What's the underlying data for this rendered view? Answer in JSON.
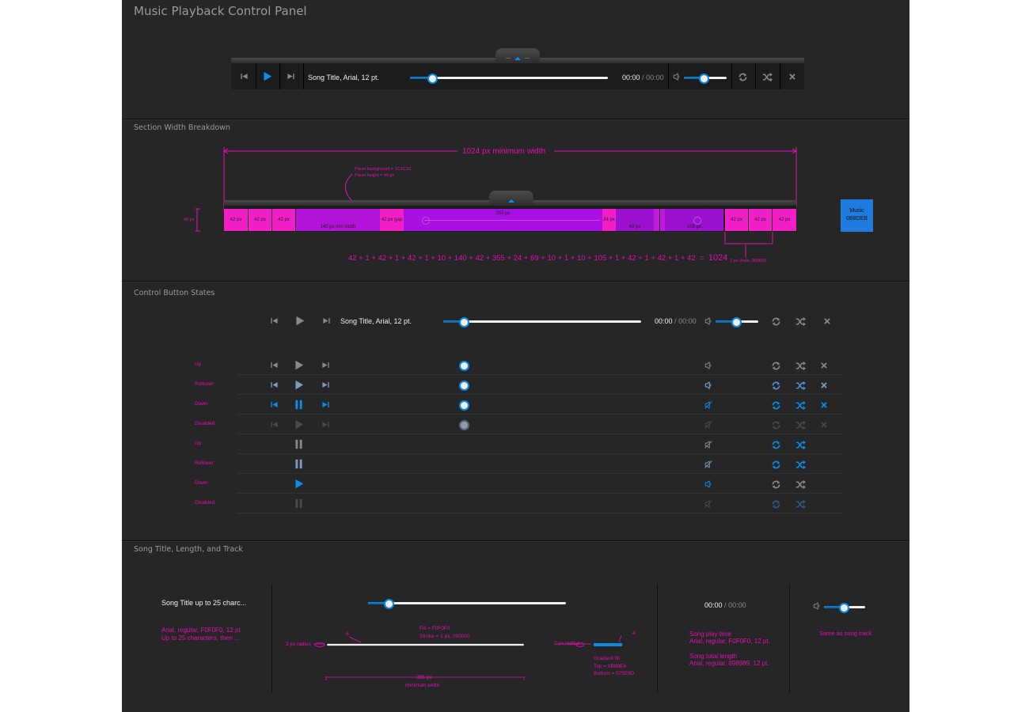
{
  "title": "Music Playback Control Panel",
  "player": {
    "song_title": "Song Title, Arial, 12 pt.",
    "time_current": "00:00",
    "time_sep": "/",
    "time_total": "00:00"
  },
  "sections": {
    "width": "Section Width Breakdown",
    "states": "Control Button States",
    "title": "Song Title, Length, and Track"
  },
  "breakdown": {
    "min_width": "1024 px minimum width",
    "panel_note_1": "Panel background = 1C1C1C",
    "panel_note_2": "Panel height = 40 px",
    "height_label": "40 px",
    "boxes": [
      "42 px",
      "42 px",
      "42 px",
      "140 px min width",
      "42 px gap",
      "355 px",
      "24 px",
      "69 px",
      "105 px",
      "42 px",
      "42 px",
      "42 px"
    ],
    "formula": "42 + 1 + 42 + 1 + 42 + 1 + 10 + 140 + 42 + 355 + 24 + 69 + 10 + 1 + 10 + 105 + 1 + 42 + 1 + 42 + 1 + 42",
    "formula_eq": "=",
    "formula_total": "1024",
    "divide_note": "1 px Vrule, 000000",
    "swatch_line1": "Music",
    "swatch_line2": "0B8DEB"
  },
  "states": {
    "labels": [
      "Up",
      "Rollover",
      "Down",
      "Disabled",
      "Up",
      "Rollover",
      "Down",
      "Disabled"
    ]
  },
  "spec": {
    "song_title": "Song Title up to 25 charc...",
    "title_note_1": "Arial, regular, F0F0F0, 12 pt",
    "title_note_2": "Up to 25 characters, then ...",
    "fill_note": "Fill = F0F0F0",
    "stroke_note": "Stroke = 1 px, 000000",
    "radius_left": "3 px radius",
    "radius_right": "2 px radius",
    "six": "6",
    "four": "4",
    "track_width": "355 px",
    "min_width": "minimum width",
    "gradient_1": "Gradient fill",
    "gradient_2": "Top = 0B89E4",
    "gradient_3": "Bottom = 075E9D",
    "time_current": "00:00",
    "time_sep": "/",
    "time_total": "00:00",
    "play_time_1": "Song play time",
    "play_time_2": "Arial, regular, F0F0F0, 12 pt.",
    "total_len_1": "Song total length",
    "total_len_2": "Arial, regular, 898989, 12 pt.",
    "same_as_track": "Same as song track"
  },
  "colors": {
    "frame": "#262626",
    "panel": "#1C1C1C",
    "accent": "#0B8DEB",
    "annotation": "#E60FB4",
    "icon_gray": "#898989"
  },
  "icons": [
    "prev-icon",
    "play-icon",
    "pause-icon",
    "next-icon",
    "volume-icon",
    "mute-icon",
    "repeat-icon",
    "shuffle-icon",
    "close-icon"
  ]
}
